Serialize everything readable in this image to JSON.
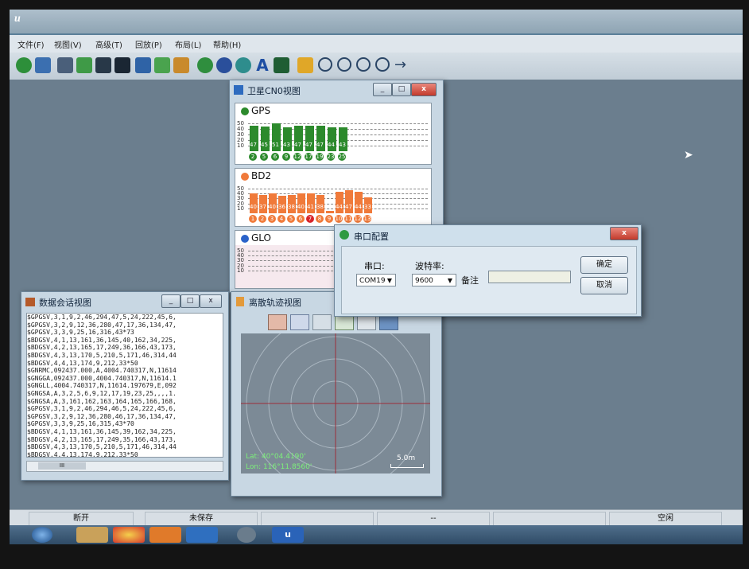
{
  "app": {
    "logo": "u"
  },
  "menu": [
    "文件(F)",
    "视图(V)",
    "高级(T)",
    "回放(P)",
    "布局(L)",
    "帮助(H)"
  ],
  "cn0_window": {
    "title": "卫星CN0视图",
    "panels": [
      {
        "name": "GPS",
        "color": "#2c8a2c",
        "values": [
          47,
          45,
          51,
          43,
          47,
          47,
          47,
          44,
          43
        ],
        "ids": [
          "2",
          "5",
          "6",
          "9",
          "12",
          "17",
          "19",
          "23",
          "25"
        ]
      },
      {
        "name": "BD2",
        "color": "#f07a3a",
        "values": [
          40,
          37,
          40,
          36,
          38,
          40,
          41,
          38,
          5,
          44,
          47,
          44,
          33
        ],
        "ids": [
          "1",
          "2",
          "3",
          "4",
          "5",
          "6",
          "7",
          "8",
          "9",
          "10",
          "11",
          "12",
          "13"
        ],
        "highlight": "7"
      },
      {
        "name": "GLO",
        "color": "#2a62c9",
        "values": []
      }
    ],
    "yticks": [
      "50",
      "40",
      "30",
      "20",
      "10"
    ],
    "bd2_label": "5"
  },
  "data_window": {
    "title": "数据会话视图",
    "lines": [
      "$GPGSV,3,1,9,2,46,294,47,5,24,222,45,6,",
      "$GPGSV,3,2,9,12,36,280,47,17,36,134,47,",
      "$GPGSV,3,3,9,25,16,316,43*73",
      "$BDGSV,4,1,13,161,36,145,40,162,34,225,",
      "$BDGSV,4,2,13,165,17,249,36,166,43,173,",
      "$BDGSV,4,3,13,170,5,210,5,171,46,314,44",
      "$BDGSV,4,4,13,174,9,212,33*50",
      "$GNRMC,092437.000,A,4004.740317,N,11614",
      "$GNGGA,092437.000,4004.740317,N,11614.1",
      "$GNGLL,4004.740317,N,11614.197679,E,092",
      "$GNGSA,A,3,2,5,6,9,12,17,19,23,25,,,,1.",
      "$GNGSA,A,3,161,162,163,164,165,166,168,",
      "$GPGSV,3,1,9,2,46,294,46,5,24,222,45,6,",
      "$GPGSV,3,2,9,12,36,280,46,17,36,134,47,",
      "$GPGSV,3,3,9,25,16,315,43*70",
      "$BDGSV,4,1,13,161,36,145,39,162,34,225,",
      "$BDGSV,4,2,13,165,17,249,35,166,43,173,",
      "$BDGSV,4,3,13,170,5,210,5,171,46,314,44",
      "$BDGSV,4,4,13,174,9,212,33*50",
      "$"
    ],
    "scroll_label": "III"
  },
  "orbit_window": {
    "title": "离散轨迹视图",
    "lat": "Lat:  40°04.4190'",
    "lon": "Lon:  116°11.8560'",
    "scale": "5.0m"
  },
  "dialog": {
    "title": "串口配置",
    "port_label": "串口:",
    "port_value": "COM19",
    "baud_label": "波特率:",
    "baud_value": "9600",
    "note_label": "备注",
    "ok_label": "确定",
    "cancel_label": "取消",
    "close_label": "x"
  },
  "status": {
    "disconnected": "断开",
    "unsaved": "未保存",
    "middle": "--",
    "idle": "空闲"
  }
}
